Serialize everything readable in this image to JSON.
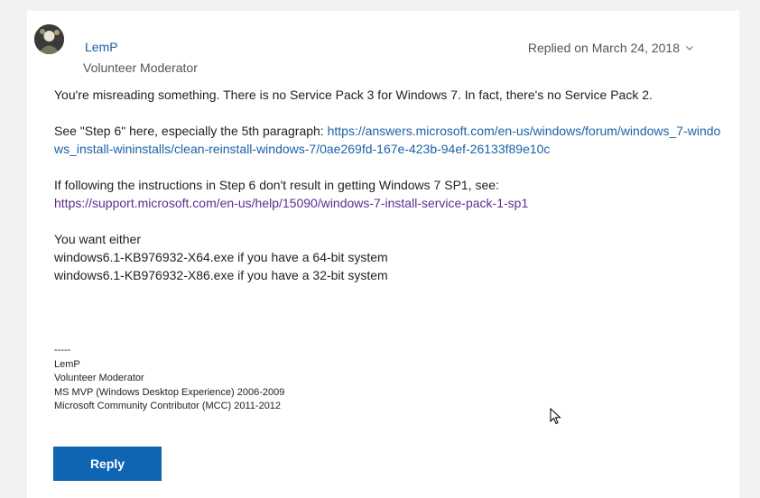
{
  "post": {
    "author": "LemP",
    "role": "Volunteer Moderator",
    "replied": "Replied on March 24, 2018",
    "body": {
      "p1": "You're misreading something.  There is no Service Pack 3 for Windows 7.  In fact, there's no Service Pack 2.",
      "p2_prefix": "See \"Step 6\" here, especially the 5th paragraph:  ",
      "p2_link": "https://answers.microsoft.com/en-us/windows/forum/windows_7-windows_install-wininstalls/clean-reinstall-windows-7/0ae269fd-167e-423b-94ef-26133f89e10c",
      "p3_text": "If following the instructions in Step 6 don't result in getting Windows 7 SP1, see:",
      "p3_link": "https://support.microsoft.com/en-us/help/15090/windows-7-install-service-pack-1-sp1",
      "p4_line1": "You want either",
      "p4_line2": "windows6.1-KB976932-X64.exe if you have a 64-bit system",
      "p4_line3": "windows6.1-KB976932-X86.exe if you have a 32-bit system"
    },
    "signature": {
      "sep": "-----",
      "name": "LemP",
      "role": "Volunteer Moderator",
      "mvp": "MS MVP (Windows Desktop Experience) 2006-2009",
      "mcc": "Microsoft Community Contributor (MCC) 2011-2012"
    },
    "reply_label": "Reply"
  },
  "colors": {
    "accent": "#0f64b4",
    "link": "#1b62a8",
    "visited_link": "#5c2d91"
  },
  "icons": {
    "chevron": "chevron-down-icon",
    "avatar": "avatar",
    "cursor": "mouse-cursor-icon"
  }
}
